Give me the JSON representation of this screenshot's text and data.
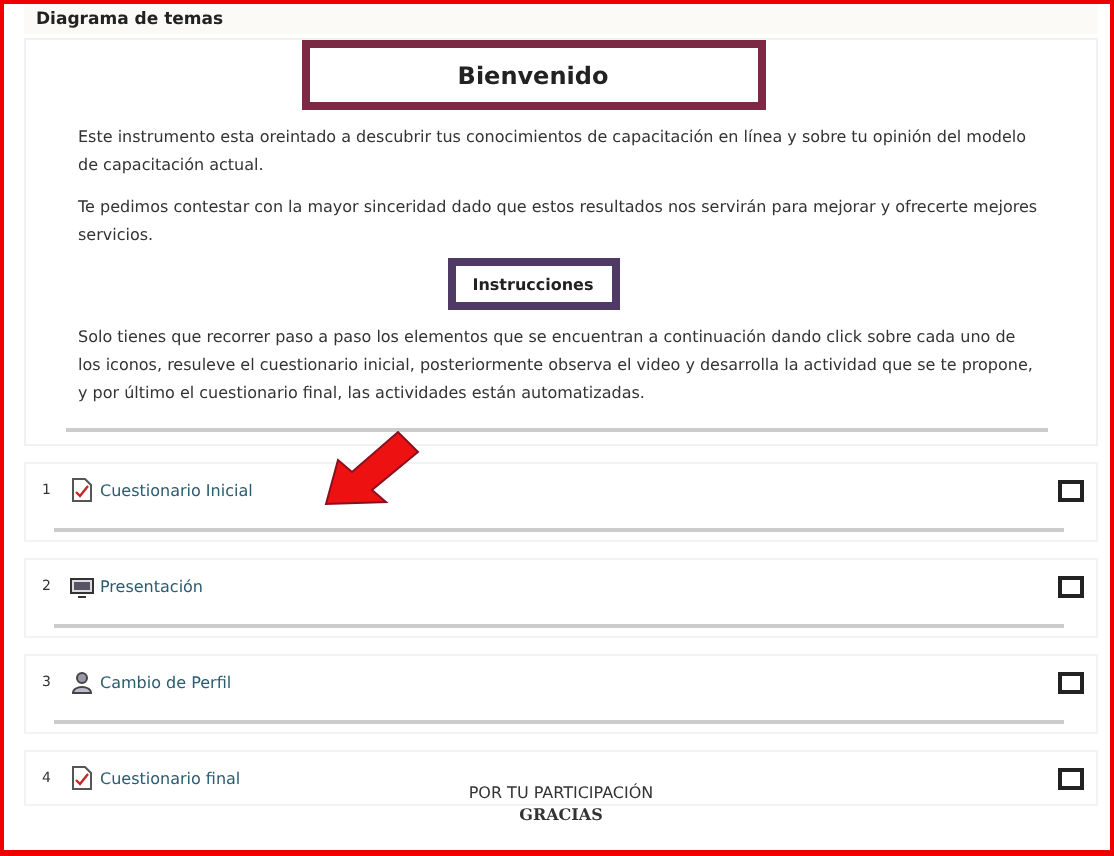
{
  "header": {
    "title": "Diagrama de temas"
  },
  "welcome": {
    "title": "Bienvenido",
    "paragraphs": [
      "Este instrumento esta oreintado a descubrir tus conocimientos de capacitación en línea y sobre tu opinión del modelo de capacitación actual.",
      "Te pedimos contestar con la mayor sinceridad dado que estos resultados nos servirán para mejorar y ofrecerte mejores servicios."
    ]
  },
  "instructions": {
    "title": "Instrucciones",
    "text": "Solo tienes que recorrer paso a paso los elementos que se encuentran a continuación dando click sobre cada uno de los iconos, resuleve el cuestionario inicial, posteriormente observa el video y desarrolla la actividad que se te propone, y por último el cuestionario final, las actividades están automatizadas."
  },
  "topics": [
    {
      "number": "1",
      "label": "Cuestionario Inicial",
      "kind": "quiz",
      "checked": false,
      "pointed": true
    },
    {
      "number": "2",
      "label": "Presentación",
      "kind": "presentation",
      "checked": false,
      "pointed": false
    },
    {
      "number": "3",
      "label": "Cambio de Perfil",
      "kind": "profile",
      "checked": false,
      "pointed": false
    },
    {
      "number": "4",
      "label": "Cuestionario final",
      "kind": "quiz",
      "checked": false,
      "pointed": false
    }
  ],
  "footer": {
    "line": "POR TU PARTICIPACIÓN",
    "thanks": "GRACIAS"
  }
}
